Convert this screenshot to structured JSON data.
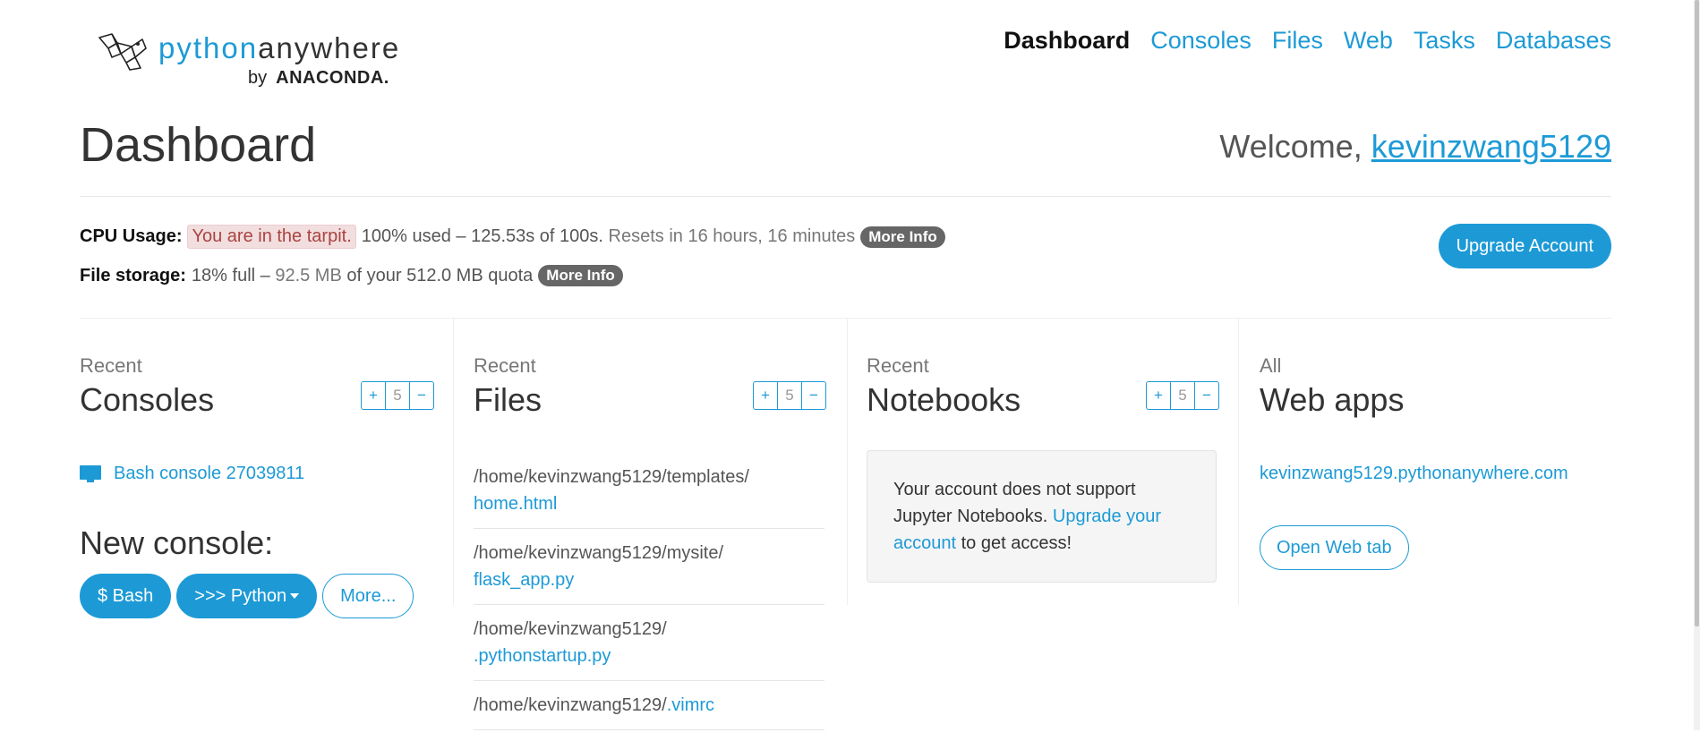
{
  "logo": {
    "word_py": "python",
    "word_any": "anywhere",
    "by": "by",
    "brand": "ANACONDA."
  },
  "nav": {
    "items": [
      "Dashboard",
      "Consoles",
      "Files",
      "Web",
      "Tasks",
      "Databases"
    ],
    "active": "Dashboard"
  },
  "page": {
    "title": "Dashboard",
    "welcome_prefix": "Welcome, ",
    "username": "kevinzwang5129"
  },
  "usage": {
    "cpu_label": "CPU Usage:",
    "cpu_tarpit": "You are in the tarpit.",
    "cpu_used": "100% used – 125.53s of 100s.",
    "cpu_reset": "Resets in 16 hours, 16 minutes",
    "storage_label": "File storage:",
    "storage_percent": "18% full –",
    "storage_used": "92.5 MB",
    "storage_quota": "of your 512.0 MB quota",
    "more_info": "More Info",
    "upgrade_button": "Upgrade Account"
  },
  "consoles": {
    "subtitle": "Recent",
    "title": "Consoles",
    "count": "5",
    "recent": [
      "Bash console 27039811"
    ],
    "new_console_title": "New console:",
    "buttons": {
      "bash": "$ Bash",
      "python": ">>> Python",
      "more": "More..."
    }
  },
  "files": {
    "subtitle": "Recent",
    "title": "Files",
    "count": "5",
    "items": [
      {
        "dir": "/home/kevinzwang5129/templates/",
        "name": "home.html"
      },
      {
        "dir": "/home/kevinzwang5129/mysite/",
        "name": "flask_app.py"
      },
      {
        "dir": "/home/kevinzwang5129/",
        "name": ".pythonstartup.py"
      },
      {
        "dir": "/home/kevinzwang5129/",
        "name": ".vimrc"
      }
    ]
  },
  "notebooks": {
    "subtitle": "Recent",
    "title": "Notebooks",
    "count": "5",
    "message_prefix": "Your account does not support Jupyter Notebooks.",
    "message_link": "Upgrade your account",
    "message_suffix": "to get access!"
  },
  "webapps": {
    "subtitle": "All",
    "title": "Web apps",
    "items": [
      "kevinzwang5129.pythonanywhere.com"
    ],
    "open_button": "Open Web tab"
  },
  "stepper_symbols": {
    "plus": "+",
    "minus": "−"
  },
  "colors": {
    "accent": "#1d9ad6",
    "tarpit_bg": "#f2dede",
    "tarpit_text": "#a94442",
    "badge": "#666666"
  }
}
